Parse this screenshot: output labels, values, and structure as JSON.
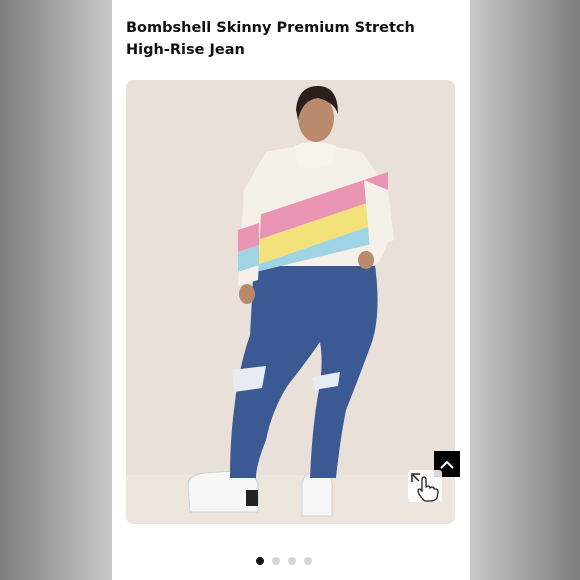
{
  "product": {
    "title": "Bombshell Skinny Premium Stretch High-Rise Jean"
  },
  "gallery": {
    "image_count": 4,
    "active_index": 0
  },
  "colors": {
    "background_card": "#ffffff",
    "photo_backdrop": "#e9e1d9",
    "denim": "#3b5a93",
    "stripe_pink": "#ea94b4",
    "stripe_yellow": "#f3e27a",
    "stripe_blue": "#9ed4e4"
  },
  "icons": {
    "scroll_top": "chevron-up-icon",
    "cursor": "hand-pointer-icon"
  }
}
